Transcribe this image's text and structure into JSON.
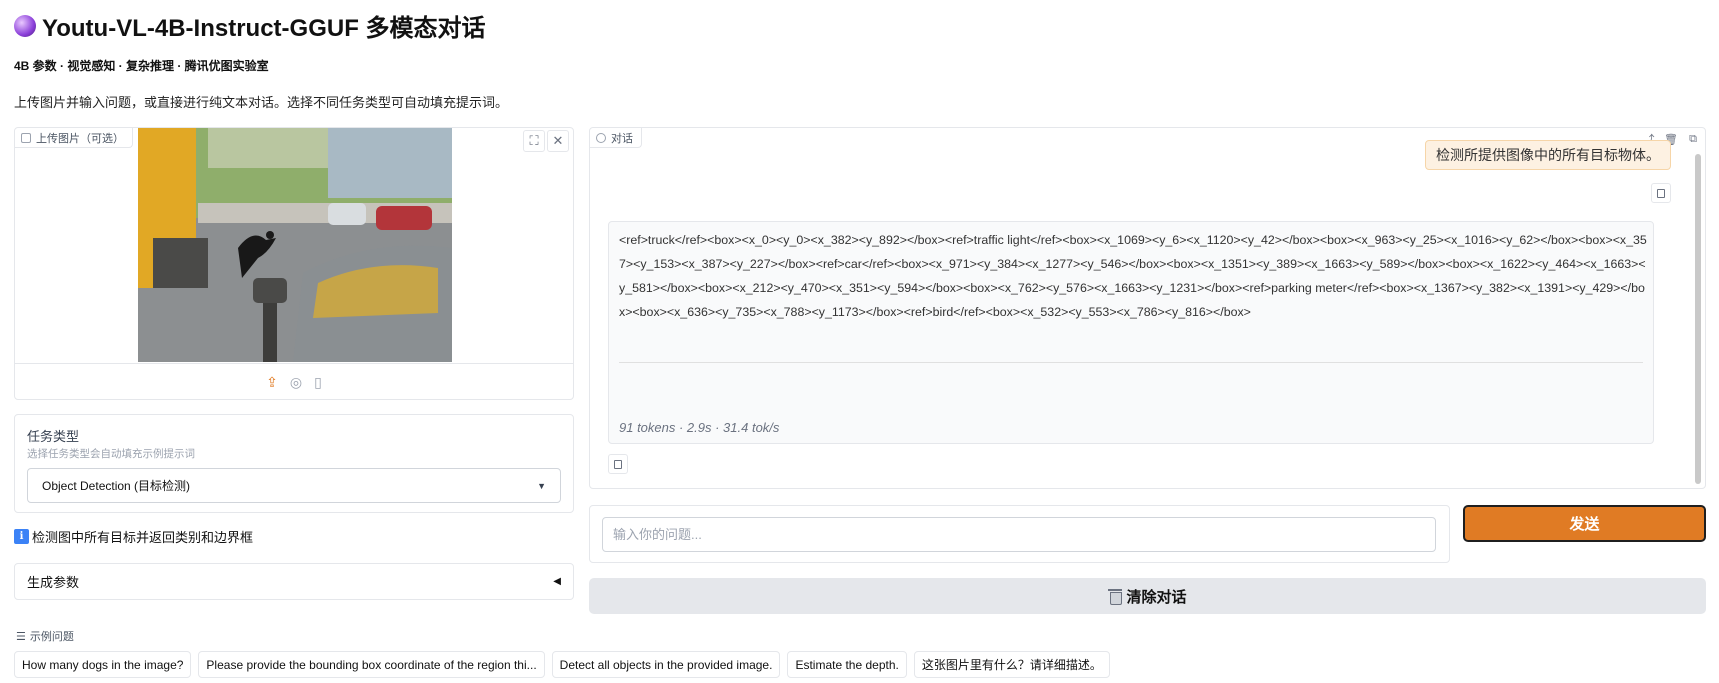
{
  "app": {
    "title": "Youtu-VL-4B-Instruct-GGUF 多模态对话",
    "subtitle": "4B 参数 · 视觉感知 · 复杂推理 · 腾讯优图实验室",
    "description": "上传图片并输入问题，或直接进行纯文本对话。选择不同任务类型可自动填充提示词。"
  },
  "upload": {
    "label": "上传图片（可选）",
    "sources": [
      "upload-icon",
      "webcam-icon",
      "clipboard-icon"
    ]
  },
  "task": {
    "label": "任务类型",
    "info": "选择任务类型会自动填充示例提示词",
    "selected": "Object Detection (目标检测)"
  },
  "hint": "检测图中所有目标并返回类别和边界框",
  "params": {
    "label": "生成参数",
    "arrow": "◀"
  },
  "examples": {
    "label": "示例问题",
    "items": [
      "How many dogs in the image?",
      "Please provide the bounding box coordinate of the region thi...",
      "Detect all objects in the provided image.",
      "Estimate the depth.",
      "这张图片里有什么？请详细描述。"
    ]
  },
  "chat": {
    "label": "对话",
    "user_message": "检测所提供图像中的所有目标物体。",
    "bot_message": "<ref>truck</ref><box><x_0><y_0><x_382><y_892></box><ref>traffic light</ref><box><x_1069><y_6><x_1120><y_42></box><box><x_963><y_25><x_1016><y_62></box><box><x_357><y_153><x_387><y_227></box><ref>car</ref><box><x_971><y_384><x_1277><y_546></box><box><x_1351><y_389><x_1663><y_589></box><box><x_1622><y_464><x_1663><y_581></box><box><x_212><y_470><x_351><y_594></box><box><x_762><y_576><x_1663><y_1231></box><ref>parking meter</ref><box><x_1367><y_382><x_1391><y_429></box><box><x_636><y_735><x_788><y_1173></box><ref>bird</ref><box><x_532><y_553><x_786><y_816></box>",
    "stats": "91 tokens · 2.9s · 31.4 tok/s"
  },
  "input": {
    "placeholder": "输入你的问题...",
    "value": ""
  },
  "buttons": {
    "send": "发送",
    "clear": "清除对话"
  },
  "colors": {
    "accent": "#e07b24",
    "user_bubble": "#fdf1e2",
    "clear_bg": "#e5e7eb"
  }
}
